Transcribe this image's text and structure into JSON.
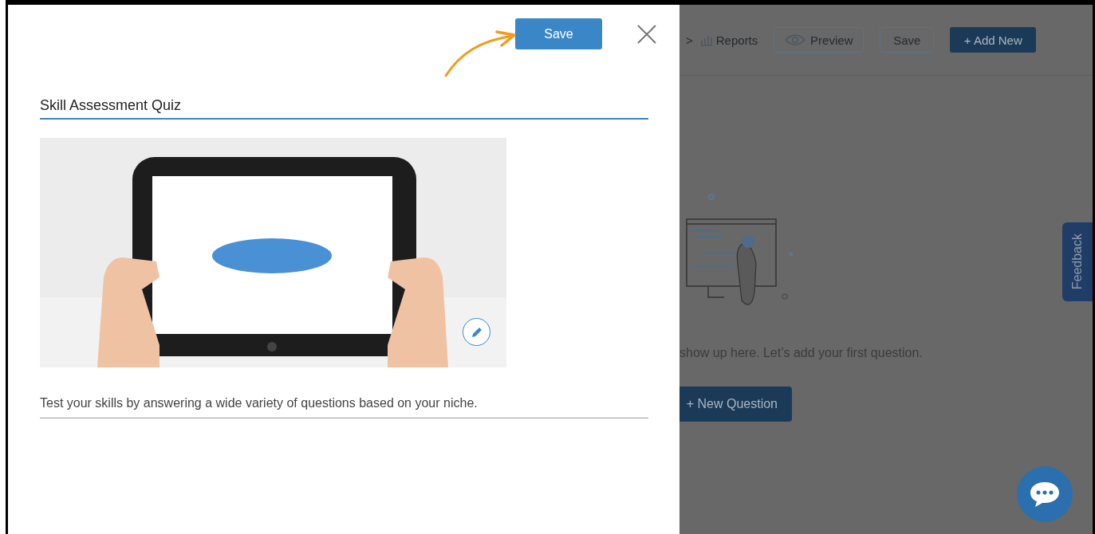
{
  "dialog": {
    "save_button": "Save",
    "title_field": {
      "value": "Skill Assessment Quiz"
    },
    "description_field": {
      "value": "Test your skills by answering a wide variety of questions based on your niche."
    }
  },
  "background_page": {
    "breadcrumb_separator": ">",
    "reports_link": "Reports",
    "buttons": [
      {
        "label": "Preview",
        "kind": "outline-icon"
      },
      {
        "label": "Save",
        "kind": "outline"
      },
      {
        "label": "+ Add New",
        "kind": "primary"
      }
    ],
    "empty_message": "show up here. Let’s add your first question.",
    "new_question_button": "+ New Question"
  },
  "feedback_tab": "Feedback"
}
